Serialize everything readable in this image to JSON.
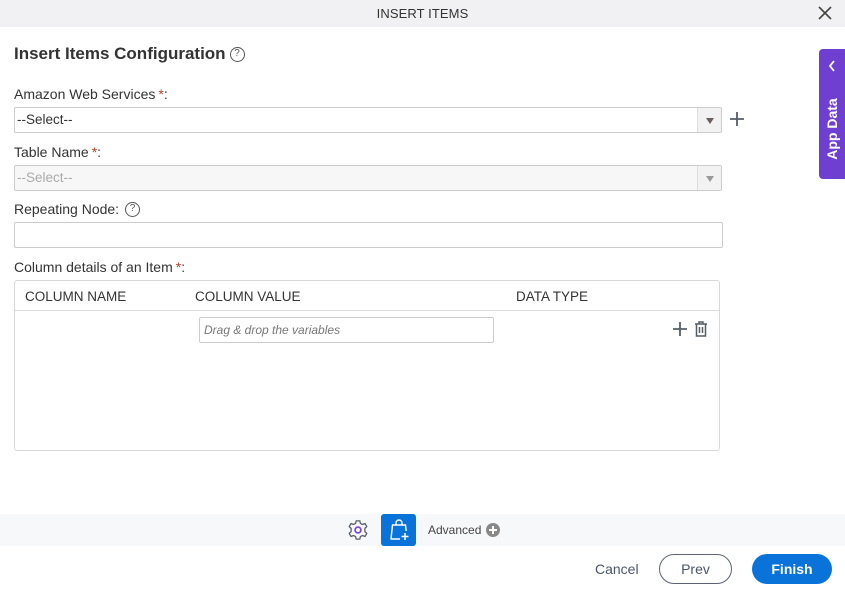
{
  "window": {
    "title": "INSERT ITEMS",
    "close_icon": "close-icon"
  },
  "heading": {
    "title": "Insert Items Configuration",
    "help_glyph": "?"
  },
  "fields": {
    "aws": {
      "label": "Amazon Web Services",
      "required_mark": "*",
      "suffix": ":",
      "value": "--Select--"
    },
    "table_name": {
      "label": "Table Name",
      "required_mark": "*",
      "suffix": ":",
      "value": "--Select--",
      "disabled": true
    },
    "repeating_node": {
      "label": "Repeating Node:",
      "help_glyph": "?",
      "value": ""
    },
    "column_details": {
      "label": "Column details of an Item",
      "required_mark": "*",
      "suffix": ":"
    }
  },
  "table": {
    "columns": [
      "COLUMN NAME",
      "COLUMN VALUE",
      "DATA TYPE"
    ],
    "rows": [
      {
        "column_name": "",
        "column_value_placeholder": "Drag & drop the variables",
        "data_type": ""
      }
    ]
  },
  "side_panel": {
    "label": "App Data",
    "color": "#6f3fd1"
  },
  "bottom_toolbar": {
    "advanced_label": "Advanced"
  },
  "footer": {
    "cancel_label": "Cancel",
    "prev_label": "Prev",
    "finish_label": "Finish",
    "accent_color": "#0a73d9"
  }
}
